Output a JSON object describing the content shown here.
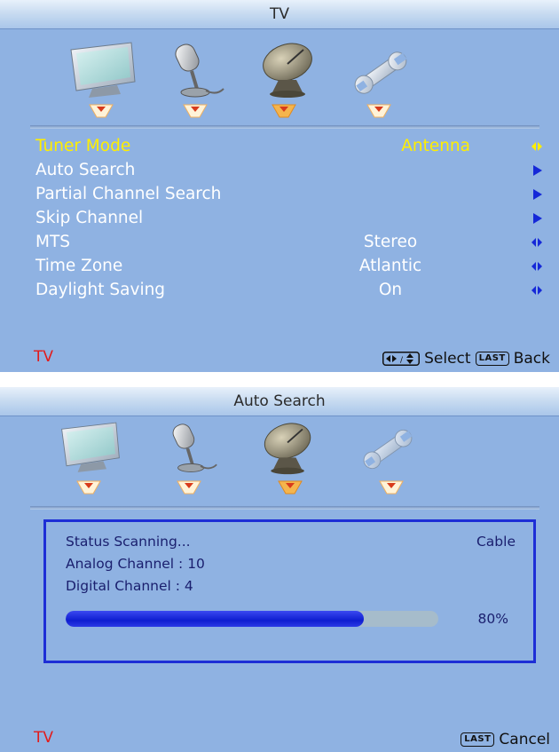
{
  "colors": {
    "panel_bg": "#8fb2e2",
    "selected": "#ffee00",
    "footer_label": "#e21b1b",
    "box_border": "#1d2ed6",
    "progress_fill": "#1a28e0"
  },
  "screen1": {
    "title": "TV",
    "icons": [
      "tv-monitor-icon",
      "microphone-icon",
      "satellite-dish-icon",
      "wrench-icon"
    ],
    "menu": [
      {
        "label": "Tuner Mode",
        "value": "Antenna",
        "arrow": "left-right",
        "selected": true
      },
      {
        "label": "Auto Search",
        "value": "",
        "arrow": "right",
        "selected": false
      },
      {
        "label": "Partial Channel Search",
        "value": "",
        "arrow": "right",
        "selected": false
      },
      {
        "label": "Skip Channel",
        "value": "",
        "arrow": "right",
        "selected": false
      },
      {
        "label": "MTS",
        "value": "Stereo",
        "arrow": "left-right",
        "selected": false
      },
      {
        "label": "Time Zone",
        "value": "Atlantic",
        "arrow": "left-right",
        "selected": false
      },
      {
        "label": "Daylight Saving",
        "value": "On",
        "arrow": "left-right",
        "selected": false
      }
    ],
    "footer": {
      "label": "TV",
      "select_text": "Select",
      "back_key": "LAST",
      "back_text": "Back"
    }
  },
  "screen2": {
    "title": "Auto Search",
    "status": "Status Scanning...",
    "source": "Cable",
    "analog": "Analog Channel : 10",
    "digital": "Digital Channel : 4",
    "progress": 0.8,
    "progress_text": "80%",
    "footer": {
      "label": "TV",
      "cancel_key": "LAST",
      "cancel_text": "Cancel"
    }
  }
}
